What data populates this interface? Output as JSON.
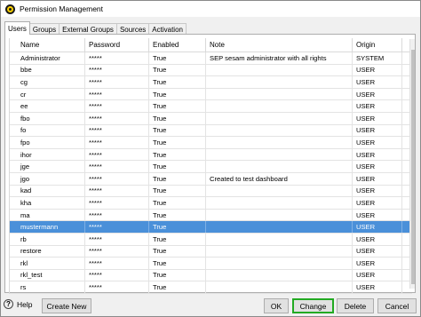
{
  "window": {
    "title": "Permission Management"
  },
  "tabs": [
    "Users",
    "Groups",
    "External Groups",
    "Sources",
    "Activation"
  ],
  "table": {
    "columns": [
      "Name",
      "Password",
      "Enabled",
      "Note",
      "Origin"
    ],
    "rows": [
      {
        "name": "Administrator",
        "password": "*****",
        "enabled": "True",
        "note": "SEP sesam administrator with all rights",
        "origin": "SYSTEM"
      },
      {
        "name": "bbe",
        "password": "*****",
        "enabled": "True",
        "note": "",
        "origin": "USER"
      },
      {
        "name": "cg",
        "password": "*****",
        "enabled": "True",
        "note": "",
        "origin": "USER"
      },
      {
        "name": "cr",
        "password": "*****",
        "enabled": "True",
        "note": "",
        "origin": "USER"
      },
      {
        "name": "ee",
        "password": "*****",
        "enabled": "True",
        "note": "",
        "origin": "USER"
      },
      {
        "name": "fbo",
        "password": "*****",
        "enabled": "True",
        "note": "",
        "origin": "USER"
      },
      {
        "name": "fo",
        "password": "*****",
        "enabled": "True",
        "note": "",
        "origin": "USER"
      },
      {
        "name": "fpo",
        "password": "*****",
        "enabled": "True",
        "note": "",
        "origin": "USER"
      },
      {
        "name": "ihor",
        "password": "*****",
        "enabled": "True",
        "note": "",
        "origin": "USER"
      },
      {
        "name": "jge",
        "password": "*****",
        "enabled": "True",
        "note": "",
        "origin": "USER"
      },
      {
        "name": "jgo",
        "password": "*****",
        "enabled": "True",
        "note": "Created to test dashboard",
        "origin": "USER"
      },
      {
        "name": "kad",
        "password": "*****",
        "enabled": "True",
        "note": "",
        "origin": "USER"
      },
      {
        "name": "kha",
        "password": "*****",
        "enabled": "True",
        "note": "",
        "origin": "USER"
      },
      {
        "name": "ma",
        "password": "*****",
        "enabled": "True",
        "note": "",
        "origin": "USER"
      },
      {
        "name": "mustermann",
        "password": "*****",
        "enabled": "True",
        "note": "",
        "origin": "USER"
      },
      {
        "name": "rb",
        "password": "*****",
        "enabled": "True",
        "note": "",
        "origin": "USER"
      },
      {
        "name": "restore",
        "password": "*****",
        "enabled": "True",
        "note": "",
        "origin": "USER"
      },
      {
        "name": "rkl",
        "password": "*****",
        "enabled": "True",
        "note": "",
        "origin": "USER"
      },
      {
        "name": "rkl_test",
        "password": "*****",
        "enabled": "True",
        "note": "",
        "origin": "USER"
      },
      {
        "name": "rs",
        "password": "*****",
        "enabled": "True",
        "note": "",
        "origin": "USER"
      }
    ],
    "selected_row": "mustermann"
  },
  "buttons": {
    "help": "Help",
    "help_glyph": "?",
    "create_new": "Create New",
    "ok": "OK",
    "change": "Change",
    "delete": "Delete",
    "cancel": "Cancel"
  },
  "colors": {
    "selection": "#4a90d9",
    "focus_outline": "#22aa22"
  }
}
